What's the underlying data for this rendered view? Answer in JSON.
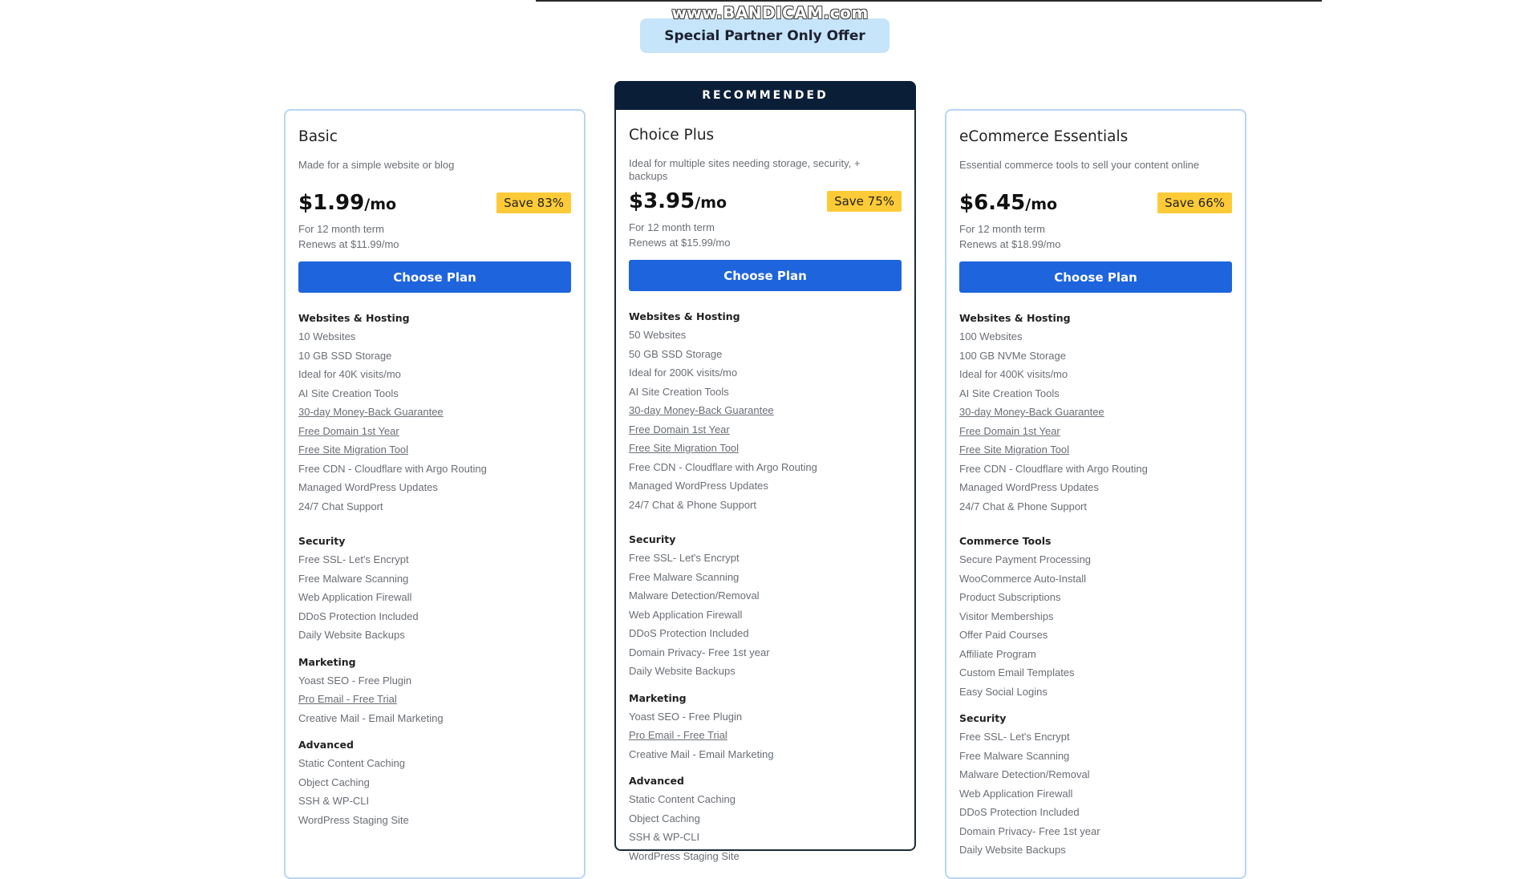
{
  "watermark": "www.BANDICAM.com",
  "offer_label": "Special Partner Only Offer",
  "recommended_label": "RECOMMENDED",
  "plans": [
    {
      "name": "Basic",
      "description": "Made for a simple website or blog",
      "price": "$1.99",
      "per": "/mo",
      "save": "Save 83%",
      "term": "For 12 month term",
      "renews": "Renews at $11.99/mo",
      "button": "Choose Plan",
      "sections": [
        {
          "title": "Websites & Hosting",
          "items": [
            {
              "text": "10 Websites"
            },
            {
              "text": "10 GB SSD Storage"
            },
            {
              "text": "Ideal for 40K visits/mo"
            },
            {
              "text": "AI Site Creation Tools"
            },
            {
              "text": "30-day Money-Back Guarantee",
              "link": true
            },
            {
              "text": "Free Domain 1st Year",
              "link": true
            },
            {
              "text": "Free Site Migration Tool",
              "link": true
            },
            {
              "text": "Free CDN - Cloudflare with Argo Routing"
            },
            {
              "text": "Managed WordPress Updates"
            },
            {
              "text": "24/7 Chat Support"
            }
          ]
        },
        {
          "title": "Security",
          "items": [
            {
              "text": "Free SSL- Let's Encrypt"
            },
            {
              "text": "Free Malware Scanning"
            },
            {
              "text": "Web Application Firewall"
            },
            {
              "text": "DDoS Protection Included"
            },
            {
              "text": "Daily Website Backups"
            }
          ]
        },
        {
          "title": "Marketing",
          "items": [
            {
              "text": "Yoast SEO - Free Plugin"
            },
            {
              "text": "Pro Email - Free Trial",
              "link": true
            },
            {
              "text": "Creative Mail - Email Marketing"
            }
          ]
        },
        {
          "title": "Advanced",
          "items": [
            {
              "text": "Static Content Caching"
            },
            {
              "text": "Object Caching"
            },
            {
              "text": "SSH & WP-CLI"
            },
            {
              "text": "WordPress Staging Site"
            }
          ]
        }
      ]
    },
    {
      "name": "Choice Plus",
      "description": "Ideal for multiple sites needing storage, security, + backups",
      "price": "$3.95",
      "per": "/mo",
      "save": "Save 75%",
      "term": "For 12 month term",
      "renews": "Renews at $15.99/mo",
      "button": "Choose Plan",
      "sections": [
        {
          "title": "Websites & Hosting",
          "items": [
            {
              "text": "50 Websites"
            },
            {
              "text": "50 GB SSD Storage"
            },
            {
              "text": "Ideal for 200K visits/mo"
            },
            {
              "text": "AI Site Creation Tools"
            },
            {
              "text": "30-day Money-Back Guarantee",
              "link": true
            },
            {
              "text": "Free Domain 1st Year",
              "link": true
            },
            {
              "text": "Free Site Migration Tool",
              "link": true
            },
            {
              "text": "Free CDN - Cloudflare with Argo Routing"
            },
            {
              "text": "Managed WordPress Updates"
            },
            {
              "text": "24/7 Chat & Phone Support"
            }
          ]
        },
        {
          "title": "Security",
          "items": [
            {
              "text": "Free SSL- Let's Encrypt"
            },
            {
              "text": "Free Malware Scanning"
            },
            {
              "text": "Malware Detection/Removal"
            },
            {
              "text": "Web Application Firewall"
            },
            {
              "text": "DDoS Protection Included"
            },
            {
              "text": "Domain Privacy- Free 1st year"
            },
            {
              "text": "Daily Website Backups"
            }
          ]
        },
        {
          "title": "Marketing",
          "items": [
            {
              "text": "Yoast SEO - Free Plugin"
            },
            {
              "text": "Pro Email - Free Trial",
              "link": true
            },
            {
              "text": "Creative Mail - Email Marketing"
            }
          ]
        },
        {
          "title": "Advanced",
          "items": [
            {
              "text": "Static Content Caching"
            },
            {
              "text": "Object Caching"
            },
            {
              "text": "SSH & WP-CLI"
            },
            {
              "text": "WordPress Staging Site"
            }
          ]
        }
      ]
    },
    {
      "name": "eCommerce Essentials",
      "description": "Essential commerce tools to sell your content online",
      "price": "$6.45",
      "per": "/mo",
      "save": "Save 66%",
      "term": "For 12 month term",
      "renews": "Renews at $18.99/mo",
      "button": "Choose Plan",
      "sections": [
        {
          "title": "Websites & Hosting",
          "items": [
            {
              "text": "100 Websites"
            },
            {
              "text": "100 GB NVMe Storage"
            },
            {
              "text": "Ideal for 400K visits/mo"
            },
            {
              "text": "AI Site Creation Tools"
            },
            {
              "text": "30-day Money-Back Guarantee",
              "link": true
            },
            {
              "text": "Free Domain 1st Year",
              "link": true
            },
            {
              "text": "Free Site Migration Tool",
              "link": true
            },
            {
              "text": "Free CDN - Cloudflare with Argo Routing"
            },
            {
              "text": "Managed WordPress Updates"
            },
            {
              "text": "24/7 Chat & Phone Support"
            }
          ]
        },
        {
          "title": "Commerce Tools",
          "items": [
            {
              "text": "Secure Payment Processing"
            },
            {
              "text": "WooCommerce Auto-Install"
            },
            {
              "text": "Product Subscriptions"
            },
            {
              "text": "Visitor Memberships"
            },
            {
              "text": "Offer Paid Courses"
            },
            {
              "text": "Affiliate Program"
            },
            {
              "text": "Custom Email Templates"
            },
            {
              "text": "Easy Social Logins"
            }
          ]
        },
        {
          "title": "Security",
          "items": [
            {
              "text": "Free SSL- Let's Encrypt"
            },
            {
              "text": "Free Malware Scanning"
            },
            {
              "text": "Malware Detection/Removal"
            },
            {
              "text": "Web Application Firewall"
            },
            {
              "text": "DDoS Protection Included"
            },
            {
              "text": "Domain Privacy- Free 1st year"
            },
            {
              "text": "Daily Website Backups"
            }
          ]
        }
      ]
    }
  ]
}
